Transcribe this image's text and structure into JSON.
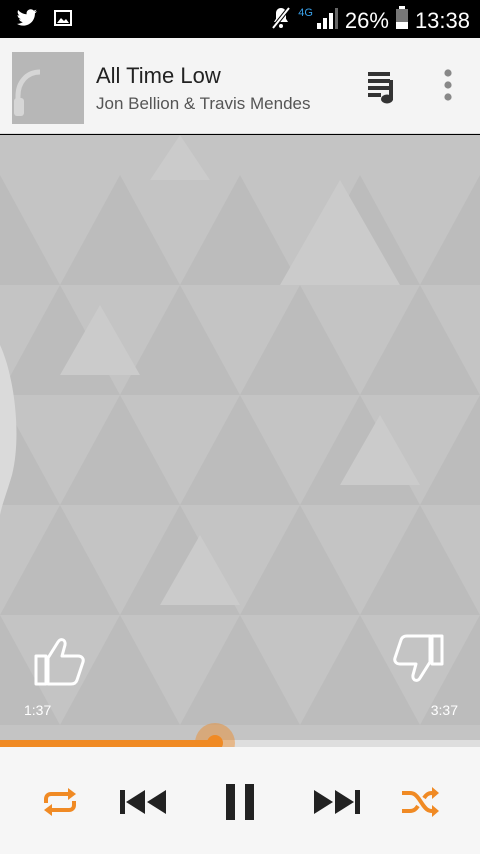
{
  "status_bar": {
    "network_label": "4G",
    "battery_percent": "26%",
    "time": "13:38",
    "icons": [
      "twitter-icon",
      "image-icon",
      "mute-icon",
      "signal-icon",
      "battery-icon"
    ]
  },
  "now_playing": {
    "title": "All Time Low",
    "artist": "Jon Bellion & Travis Mendes"
  },
  "playback": {
    "elapsed": "1:37",
    "total": "3:37",
    "progress_fraction": 0.447,
    "is_playing": true
  },
  "colors": {
    "accent": "#f08a24",
    "header_bg": "#f4f4f4",
    "art_bg": "#c3c3c3",
    "controls_bg": "#f6f6f6"
  }
}
